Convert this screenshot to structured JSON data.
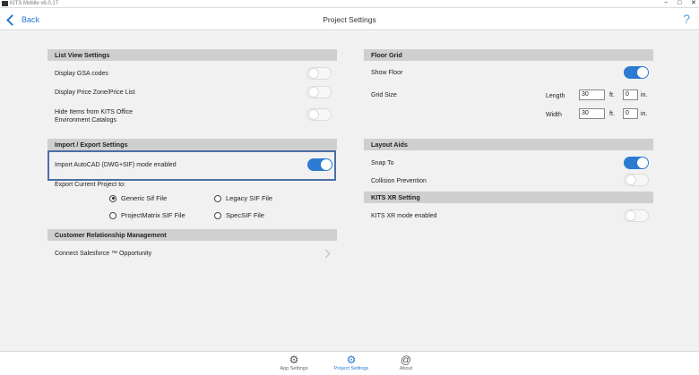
{
  "window": {
    "title": "KITS Mobile v6.0.17",
    "minimize_glyph": "−",
    "maximize_glyph": "□",
    "close_glyph": "✕"
  },
  "header": {
    "back_label": "Back",
    "title": "Project Settings",
    "help_glyph": "?"
  },
  "list_view": {
    "heading": "List View Settings",
    "items": [
      {
        "label": "Display GSA codes",
        "on": false
      },
      {
        "label": "Display Price Zone/Price List",
        "on": false
      },
      {
        "label_line1": "Hide Items from KITS Office",
        "label_line2": "Environment Catalogs",
        "on": false
      }
    ]
  },
  "import_export": {
    "heading": "Import / Export Settings",
    "import_label": "Import AutoCAD (DWG+SIF) mode enabled",
    "import_on": true,
    "export_label": "Export Current Project to:",
    "options": [
      {
        "label": "Generic Sif File",
        "selected": true
      },
      {
        "label": "Legacy SIF File",
        "selected": false
      },
      {
        "label": "ProjectMatrix SIF File",
        "selected": false
      },
      {
        "label": "SpecSIF File",
        "selected": false
      }
    ]
  },
  "crm": {
    "heading": "Customer Relationship Management",
    "connect_label": "Connect Salesforce ™ Opportunity"
  },
  "floor_grid": {
    "heading": "Floor Grid",
    "show_floor_label": "Show Floor",
    "show_floor_on": true,
    "grid_size_label": "Grid Size",
    "length_label": "Length",
    "length_ft": "30",
    "length_in": "0",
    "width_label": "Width",
    "width_ft": "30",
    "width_in": "0",
    "ft_unit": "ft.",
    "in_unit": "in."
  },
  "layout_aids": {
    "heading": "Layout Aids",
    "snap_label": "Snap To",
    "snap_on": true,
    "collision_label": "Collision Prevention",
    "collision_on": false
  },
  "kits_xr": {
    "heading": "KITS XR Setting",
    "mode_label": "KITS XR mode enabled",
    "mode_on": false
  },
  "footer": {
    "tabs": [
      {
        "label": "App Settings",
        "icon": "gears-icon"
      },
      {
        "label": "Project Settings",
        "icon": "gears-icon",
        "active": true
      },
      {
        "label": "About",
        "icon": "at-icon"
      }
    ]
  }
}
